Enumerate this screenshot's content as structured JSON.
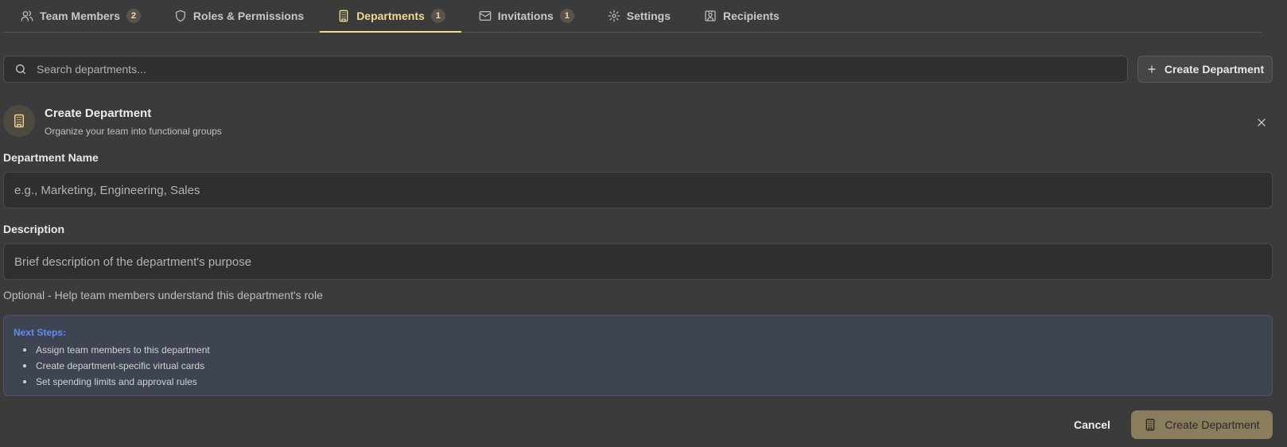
{
  "tabs": [
    {
      "label": "Team Members",
      "badge": "2",
      "icon": "users-icon"
    },
    {
      "label": "Roles & Permissions",
      "badge": null,
      "icon": "shield-icon"
    },
    {
      "label": "Departments",
      "badge": "1",
      "icon": "building-icon",
      "active": true
    },
    {
      "label": "Invitations",
      "badge": "1",
      "icon": "mail-icon"
    },
    {
      "label": "Settings",
      "badge": null,
      "icon": "gear-icon"
    },
    {
      "label": "Recipients",
      "badge": null,
      "icon": "contact-icon"
    }
  ],
  "search": {
    "placeholder": "Search departments..."
  },
  "toolbar": {
    "create_label": "Create Department"
  },
  "form": {
    "title": "Create Department",
    "subtitle": "Organize your team into functional groups",
    "name_label": "Department Name",
    "name_placeholder": "e.g., Marketing, Engineering, Sales",
    "description_label": "Description",
    "description_placeholder": "Brief description of the department's purpose",
    "description_helper": "Optional - Help team members understand this department's role"
  },
  "next_steps": {
    "title": "Next Steps:",
    "items": [
      "Assign team members to this department",
      "Create department-specific virtual cards",
      "Set spending limits and approval rules"
    ]
  },
  "footer": {
    "cancel_label": "Cancel",
    "submit_label": "Create Department"
  },
  "colors": {
    "accent": "#f2d890",
    "submit_bg": "#8a7d5d",
    "info_title": "#5b8ef0",
    "background": "#3b3b3b"
  }
}
